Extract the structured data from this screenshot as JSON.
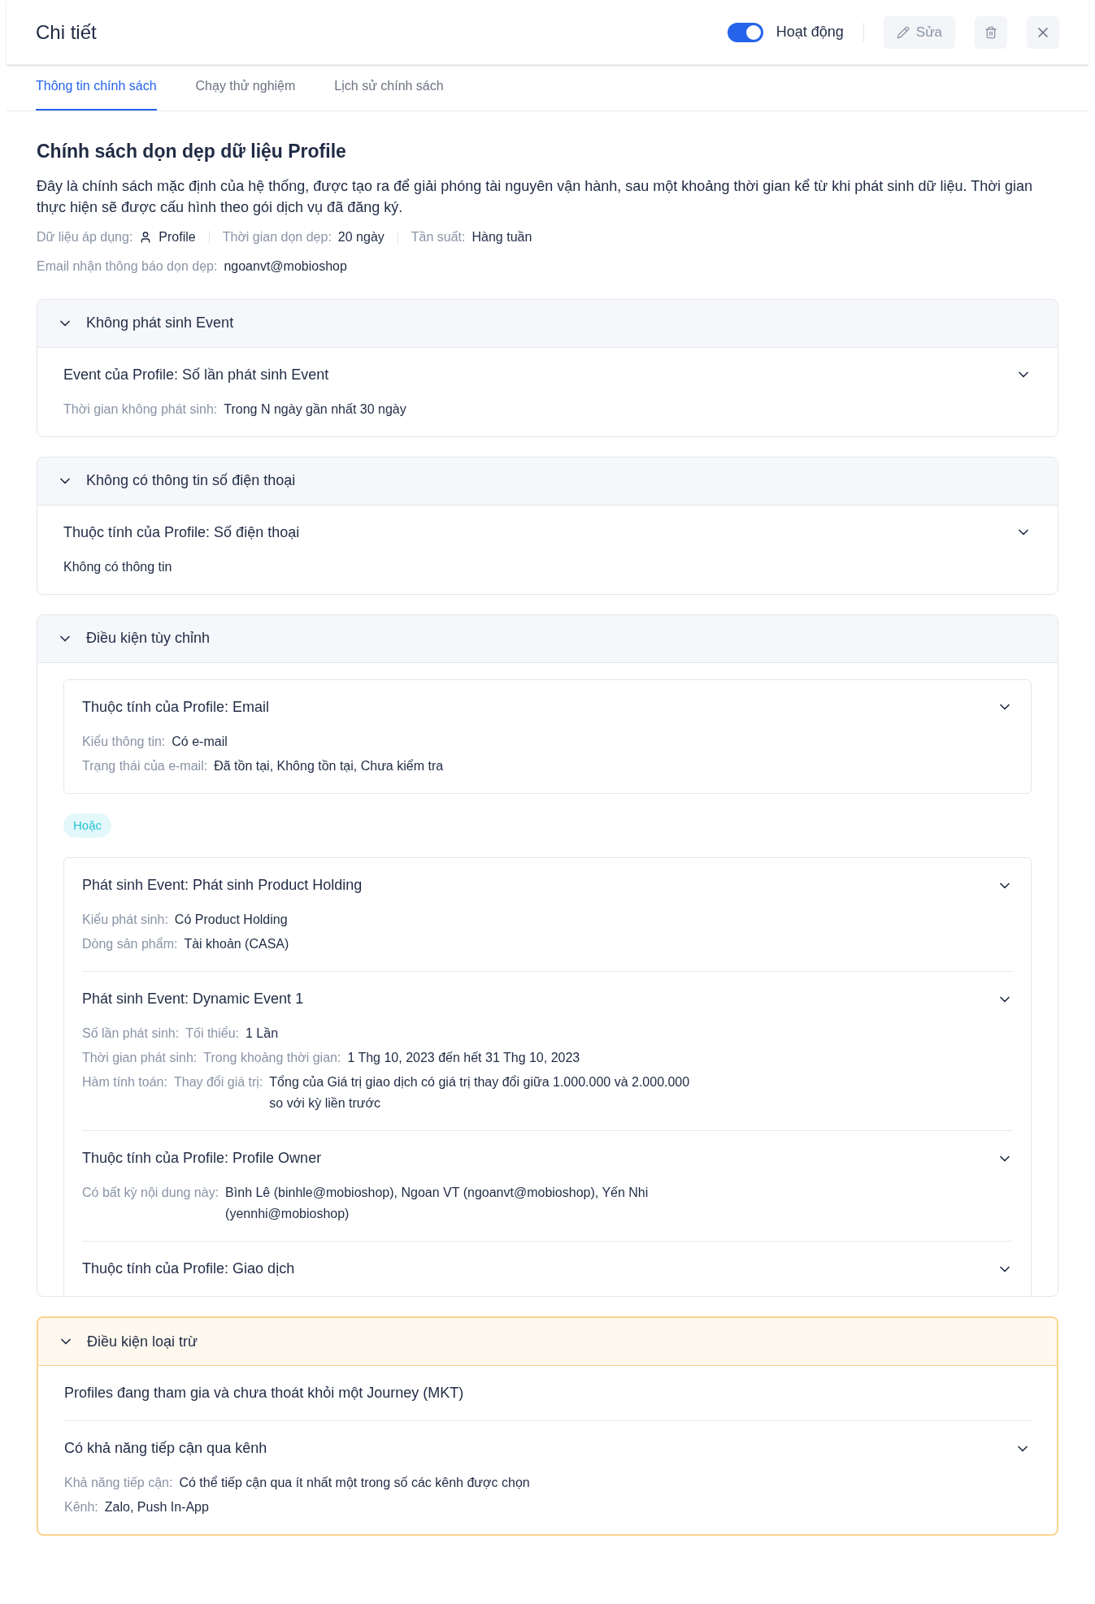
{
  "header": {
    "title": "Chi tiết",
    "status": {
      "on": true,
      "label": "Hoạt động"
    },
    "edit_label": "Sửa"
  },
  "tabs": [
    {
      "label": "Thông tin chính sách",
      "selected": true
    },
    {
      "label": "Chạy thử nghiệm",
      "selected": false
    },
    {
      "label": "Lịch sử chính sách",
      "selected": false
    }
  ],
  "policy": {
    "title": "Chính sách dọn dẹp dữ liệu Profile",
    "description": "Đây là chính sách mặc định của hệ thống, được tạo ra để giải phóng tài nguyên vận hành, sau một khoảng thời gian kể từ khi phát sinh dữ liệu. Thời gian thực hiện sẽ được cấu hình theo gói dịch vụ đã đăng ký.",
    "meta": [
      {
        "label": "Dữ liệu áp dụng:",
        "value": "Profile",
        "kind": "person"
      },
      {
        "label": "Thời gian dọn dẹp:",
        "value": "20 ngày",
        "kind": "plain"
      },
      {
        "label": "Tần suất:",
        "value": "Hàng tuần",
        "kind": "plain"
      }
    ],
    "email": {
      "label": "Email nhận thông báo dọn dẹp:",
      "value": "ngoanvt@mobioshop"
    }
  },
  "sections": [
    {
      "title": "Không phát sinh Event",
      "kind": "default",
      "expanded": true,
      "blocks": [
        {
          "kind": "flat",
          "rules": [
            {
              "title": "Event của Profile: Số lần phát sinh Event",
              "expandable": true,
              "fields": [
                {
                  "label": "Thời gian không phát sinh:",
                  "value": "Trong N ngày gần nhất 30 ngày"
                }
              ]
            }
          ]
        }
      ]
    },
    {
      "title": "Không có thông tin số điện thoại",
      "kind": "default",
      "expanded": true,
      "blocks": [
        {
          "kind": "flat",
          "rules": [
            {
              "title": "Thuộc tính của Profile: Số điện thoại",
              "expandable": true,
              "fields": [
                {
                  "value": "Không có thông tin"
                }
              ]
            }
          ]
        }
      ]
    },
    {
      "title": "Điều kiện tùy chỉnh",
      "kind": "default",
      "expanded": true,
      "clipped": true,
      "blocks": [
        {
          "kind": "group",
          "rules": [
            {
              "title": "Thuộc tính của Profile: Email",
              "expandable": true,
              "fields": [
                {
                  "label": "Kiểu thông tin:",
                  "value": "Có e-mail"
                },
                {
                  "label": "Trạng thái của e-mail:",
                  "value": "Đã tồn tại, Không tồn tại, Chưa kiểm tra"
                }
              ]
            }
          ]
        },
        {
          "kind": "operator",
          "label": "Hoặc"
        },
        {
          "kind": "group",
          "rules": [
            {
              "title": "Phát sinh Event: Phát sinh Product Holding",
              "expandable": true,
              "fields": [
                {
                  "label": "Kiểu phát sinh:",
                  "value": "Có Product Holding"
                },
                {
                  "label": "Dòng sản phẩm:",
                  "value": "Tài khoản (CASA)"
                }
              ]
            },
            {
              "title": "Phát sinh Event: Dynamic Event 1",
              "expandable": true,
              "fields": [
                {
                  "label": "Số lần phát sinh:",
                  "qualifier": "Tối thiểu:",
                  "value": "1 Lần"
                },
                {
                  "label": "Thời gian phát sinh:",
                  "qualifier": "Trong khoảng thời gian:",
                  "value": "1 Thg 10, 2023 đến hết 31 Thg 10, 2023"
                },
                {
                  "label": "Hàm tính toán:",
                  "qualifier": "Thay đổi giá trị:",
                  "value": "Tổng của Giá trị giao dịch có giá trị thay đổi giữa 1.000.000 và 2.000.000 so với kỳ liền trước"
                }
              ]
            },
            {
              "title": "Thuộc tính của Profile: Profile Owner",
              "expandable": true,
              "fields": [
                {
                  "label": "Có bất kỳ nội dung này:",
                  "value": "Bình Lê (binhle@mobioshop), Ngoan VT (ngoanvt@mobioshop), Yến Nhi (yennhi@mobioshop)"
                }
              ]
            },
            {
              "title": "Thuộc tính của Profile: Giao dịch",
              "expandable": true
            }
          ]
        }
      ]
    },
    {
      "title": "Điều kiện loại trừ",
      "kind": "exclusion",
      "expanded": true,
      "blocks": [
        {
          "kind": "flat",
          "rules": [
            {
              "title": "Profiles đang tham gia và chưa thoát khỏi một Journey (MKT)",
              "expandable": false
            },
            {
              "title": "Có khả năng tiếp cận qua kênh",
              "expandable": true,
              "fields": [
                {
                  "label": "Khả năng tiếp cận:",
                  "value": "Có thể tiếp cận qua ít nhất một trong số các kênh được chọn"
                },
                {
                  "label": "Kênh:",
                  "value": "Zalo, Push In-App"
                }
              ]
            }
          ]
        }
      ]
    }
  ]
}
